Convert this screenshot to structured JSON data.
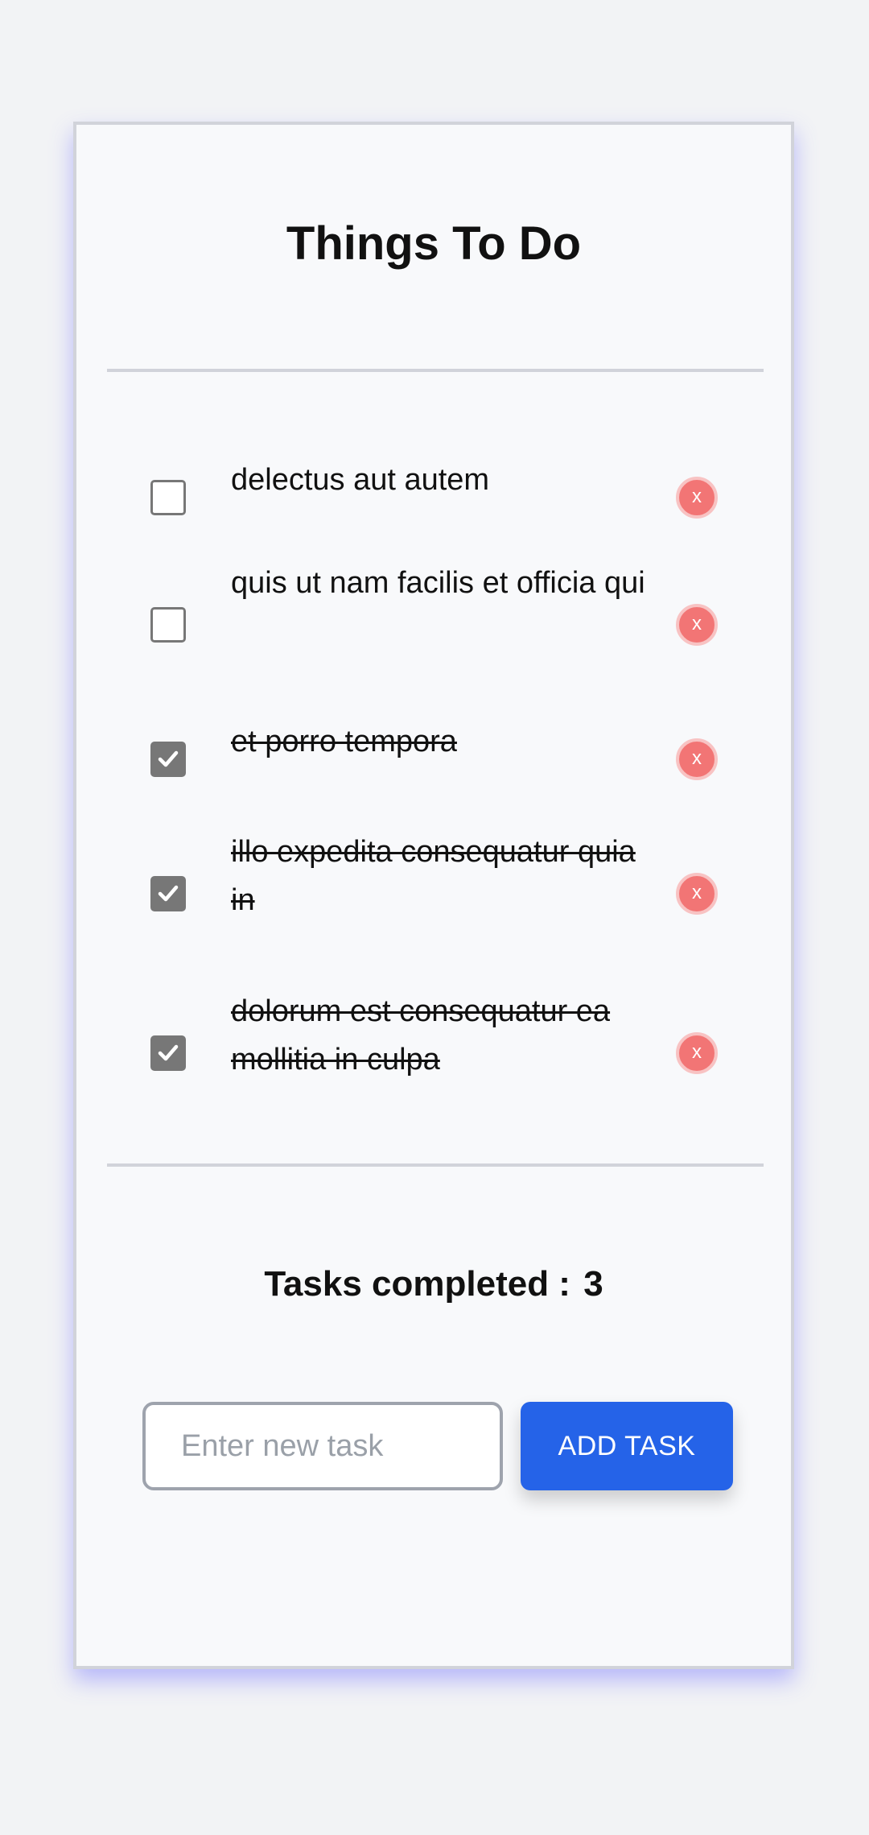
{
  "app": {
    "title": "Things To Do"
  },
  "tasks": [
    {
      "text": "delectus aut autem",
      "completed": false,
      "delete_label": "x"
    },
    {
      "text": "quis ut nam facilis et officia qui",
      "completed": false,
      "delete_label": "x"
    },
    {
      "text": "et porro tempora",
      "completed": true,
      "delete_label": "x"
    },
    {
      "text": "illo expedita consequatur quia in",
      "completed": true,
      "delete_label": "x"
    },
    {
      "text": "dolorum est consequatur ea mollitia in culpa",
      "completed": true,
      "delete_label": "x"
    }
  ],
  "summary": {
    "label": "Tasks completed :",
    "count": "3"
  },
  "new_task": {
    "placeholder": "Enter new task",
    "value": "",
    "button_label": "ADD TASK"
  },
  "icons": {
    "checkbox_checked": "checkmark-icon",
    "delete": "close-icon"
  },
  "colors": {
    "accent": "#2563e8",
    "delete": "#f27575",
    "checkbox_checked": "#777777",
    "page_background": "#f2f3f5",
    "card_background": "#f8f9fb"
  }
}
